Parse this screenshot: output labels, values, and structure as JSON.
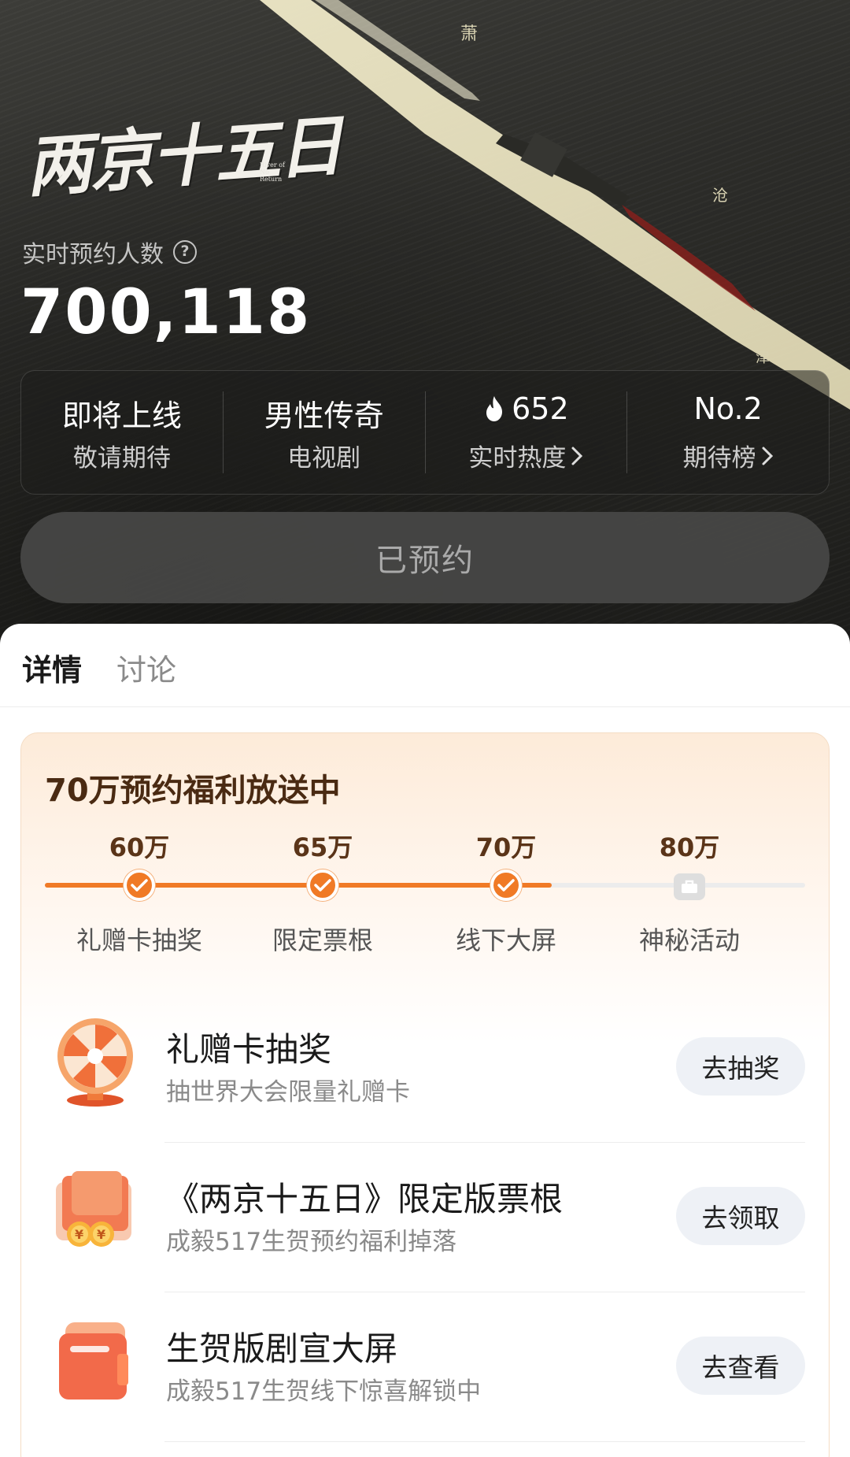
{
  "show": {
    "logo_text": "两京十五日",
    "logo_subtitle": "River of No Return"
  },
  "reservation": {
    "label": "实时预约人数",
    "count": "700,118",
    "reserved_button": "已预约"
  },
  "stats": [
    {
      "top": "即将上线",
      "bottom": "敬请期待"
    },
    {
      "top": "男性传奇",
      "bottom": "电视剧"
    },
    {
      "top": "652",
      "bottom": "实时热度"
    },
    {
      "top": "No.2",
      "bottom": "期待榜"
    }
  ],
  "tabs": [
    {
      "label": "详情",
      "active": true
    },
    {
      "label": "讨论",
      "active": false
    }
  ],
  "benefits": {
    "title": "70万预约福利放送中",
    "progress_fraction_reached": 0.667,
    "milestones": [
      {
        "amount": "60万",
        "label": "礼赠卡抽奖",
        "reached": true
      },
      {
        "amount": "65万",
        "label": "限定票根",
        "reached": true
      },
      {
        "amount": "70万",
        "label": "线下大屏",
        "reached": true
      },
      {
        "amount": "80万",
        "label": "神秘活动",
        "reached": false
      }
    ],
    "rewards": [
      {
        "title": "礼赠卡抽奖",
        "subtitle": "抽世界大会限量礼赠卡",
        "button": "去抽奖",
        "icon": "prize-wheel-icon"
      },
      {
        "title": "《两京十五日》限定版票根",
        "subtitle": "成毅517生贺预约福利掉落",
        "button": "去领取",
        "icon": "ticket-coupon-icon"
      },
      {
        "title": "生贺版剧宣大屏",
        "subtitle": "成毅517生贺线下惊喜解锁中",
        "button": "去查看",
        "icon": "billboard-card-icon"
      }
    ]
  },
  "colors": {
    "accent": "#f07a26",
    "title_brown": "#4a2a12",
    "card_bg_top": "#fdebd9"
  }
}
